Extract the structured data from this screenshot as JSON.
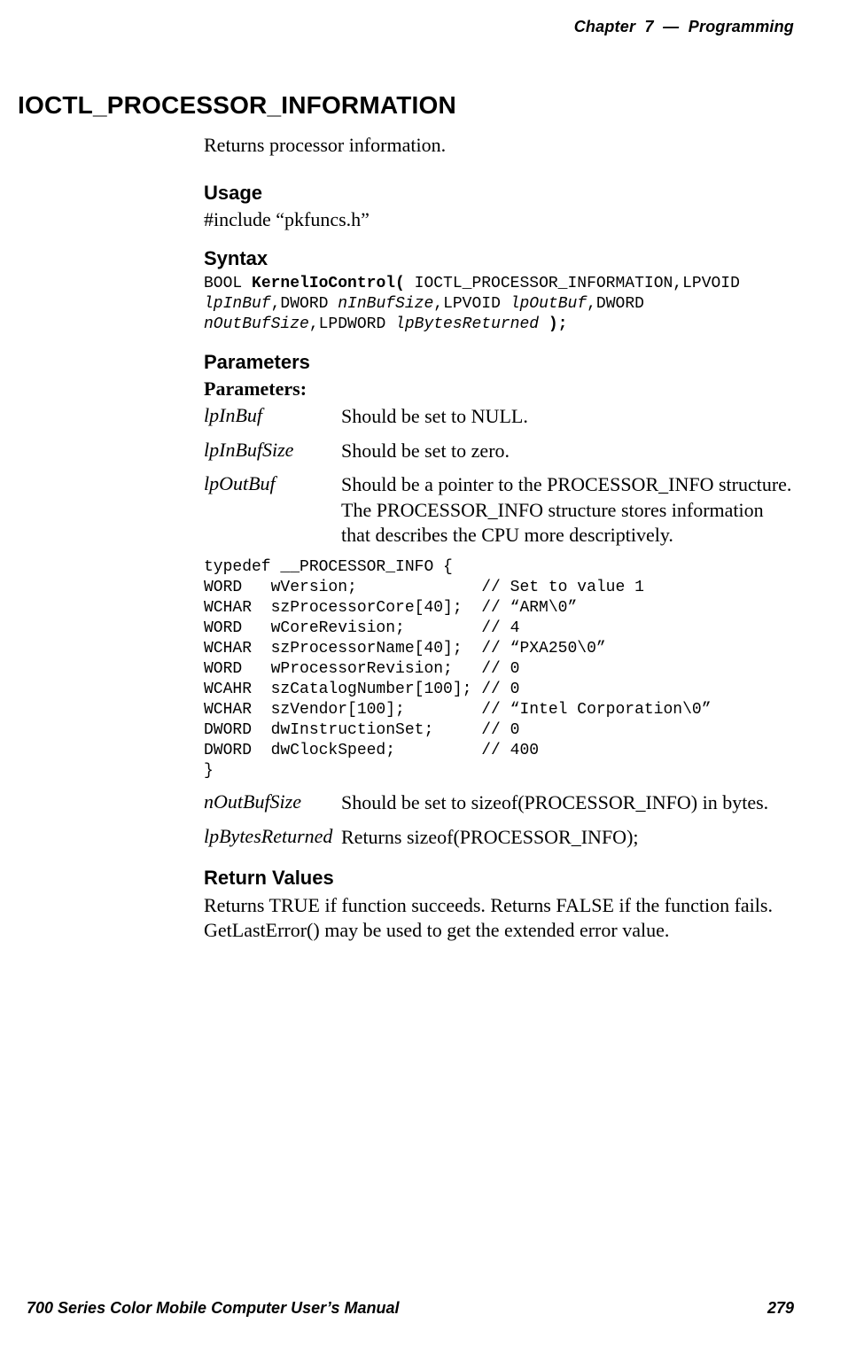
{
  "header": {
    "chapter_label": "Chapter  7",
    "separator": "  —  ",
    "chapter_title": "Programming"
  },
  "section": {
    "title": "IOCTL_PROCESSOR_INFORMATION",
    "intro": "Returns processor information."
  },
  "usage": {
    "heading": "Usage",
    "line": "#include “pkfuncs.h”"
  },
  "syntax": {
    "heading": "Syntax",
    "pre1": "BOOL ",
    "bold1": "KernelIoControl(",
    "post1": " IOCTL_PROCESSOR_INFORMATION,LPVOID",
    "it_lpInBuf": "lpInBuf",
    "mid2": ",DWORD ",
    "it_nInBufSize": "nInBufSize",
    "mid3": ",LPVOID ",
    "it_lpOutBuf": "lpOutBuf",
    "mid4": ",DWORD",
    "it_nOutBufSize": "nOutBufSize",
    "mid5": ",LPDWORD ",
    "it_lpBytesReturned": "lpBytesReturned",
    "end": " );"
  },
  "parameters": {
    "heading": "Parameters",
    "label": "Parameters:",
    "rows": {
      "lpInBuf": {
        "name": "lpInBuf",
        "desc": "Should be set to NULL."
      },
      "lpInBufSize": {
        "name": "lpInBufSize",
        "desc": "Should be set to zero."
      },
      "lpOutBuf": {
        "name": "lpOutBuf",
        "desc": "Should be a pointer to the PROCESSOR_INFO structure. The PROCESSOR_INFO structure stores information that describes the CPU more descriptively."
      },
      "nOutBufSize": {
        "name": "nOutBufSize",
        "desc": "Should be set to sizeof(PROCESSOR_INFO) in bytes."
      },
      "lpBytesReturned": {
        "name": "lpBytesReturned",
        "desc": "Returns sizeof(PROCESSOR_INFO);"
      }
    }
  },
  "struct_code": "typedef __PROCESSOR_INFO {\nWORD   wVersion;             // Set to value 1\nWCHAR  szProcessorCore[40];  // “ARM\\0”\nWORD   wCoreRevision;        // 4\nWCHAR  szProcessorName[40];  // “PXA250\\0”\nWORD   wProcessorRevision;   // 0\nWCAHR  szCatalogNumber[100]; // 0\nWCHAR  szVendor[100];        // “Intel Corporation\\0”\nDWORD  dwInstructionSet;     // 0\nDWORD  dwClockSpeed;         // 400\n}",
  "return": {
    "heading": "Return Values",
    "body": "Returns TRUE if function succeeds. Returns FALSE if the function fails. GetLastError() may be used to get the extended error value."
  },
  "footer": {
    "book_title": "700 Series Color Mobile Computer User’s Manual",
    "page_number": "279"
  }
}
